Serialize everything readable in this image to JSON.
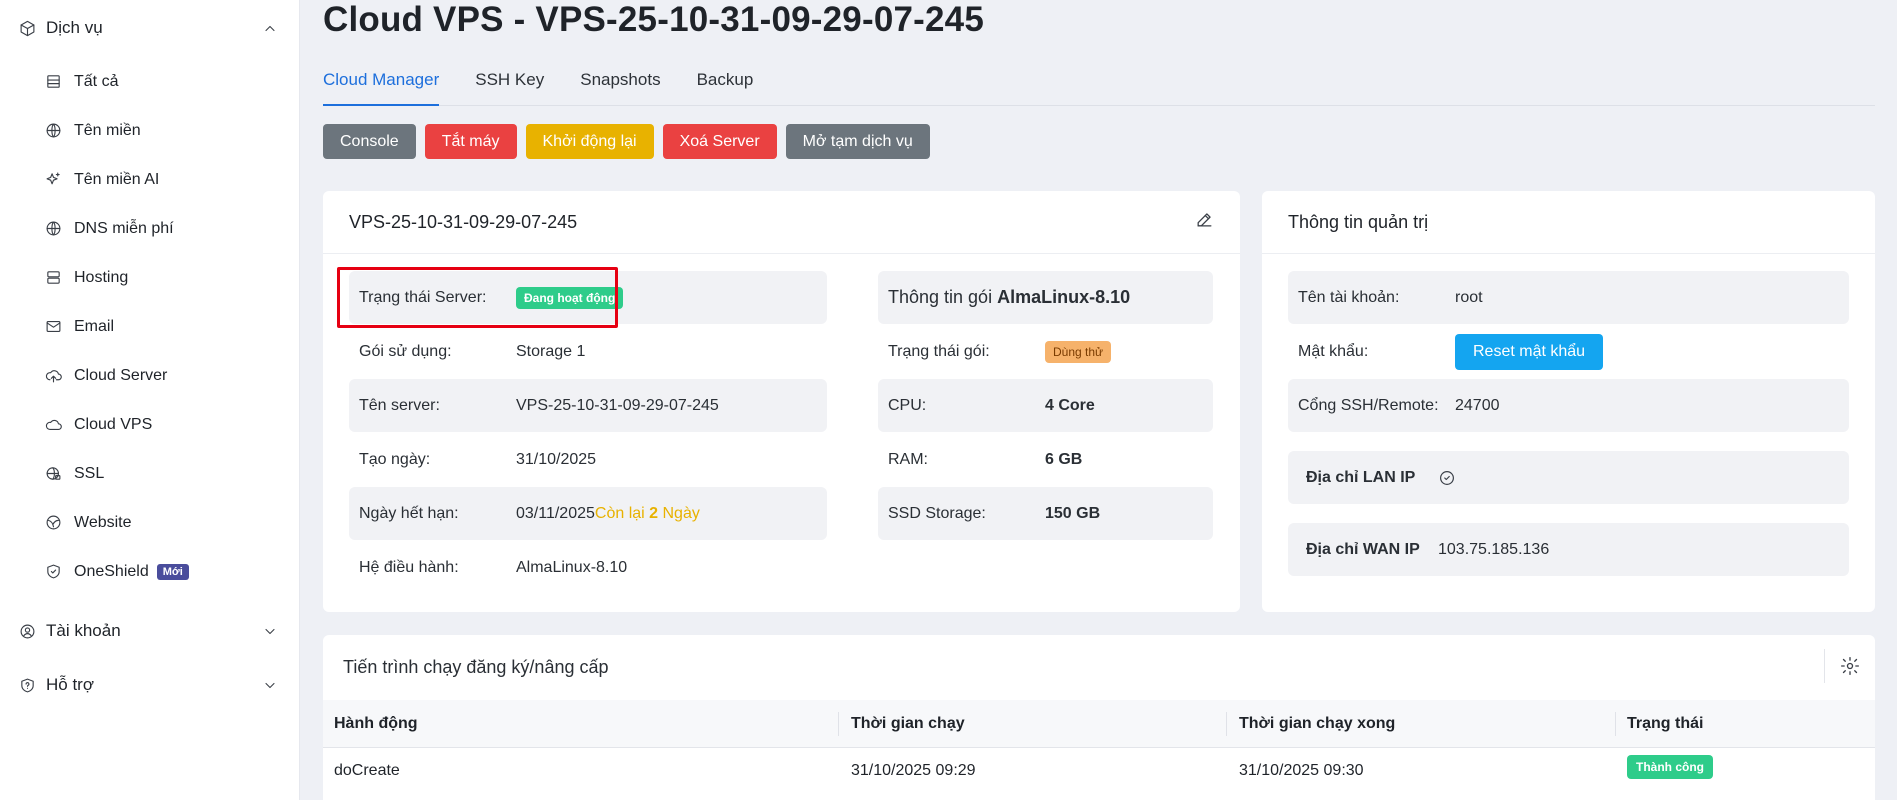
{
  "sidebar": {
    "services_group": "Dịch vụ",
    "items": [
      {
        "label": "Tất cả",
        "icon": "table-icon"
      },
      {
        "label": "Tên miền",
        "icon": "globe-icon"
      },
      {
        "label": "Tên miền AI",
        "icon": "sparkle-icon"
      },
      {
        "label": "DNS miễn phí",
        "icon": "globe-icon"
      },
      {
        "label": "Hosting",
        "icon": "server-icon"
      },
      {
        "label": "Email",
        "icon": "mail-icon"
      },
      {
        "label": "Cloud Server",
        "icon": "cloud-upload-icon"
      },
      {
        "label": "Cloud VPS",
        "icon": "cloud-icon"
      },
      {
        "label": "SSL",
        "icon": "globe-lock-icon"
      },
      {
        "label": "Website",
        "icon": "web-icon"
      },
      {
        "label": "OneShield",
        "icon": "shield-icon",
        "badge": "Mới"
      }
    ],
    "account_group": "Tài khoản",
    "support_group": "Hỗ trợ"
  },
  "page": {
    "title": "Cloud VPS - VPS-25-10-31-09-29-07-245",
    "tabs": [
      "Cloud Manager",
      "SSH Key",
      "Snapshots",
      "Backup"
    ],
    "active_tab": "Cloud Manager"
  },
  "actions": {
    "console": "Console",
    "shutdown": "Tắt máy",
    "restart": "Khởi động lại",
    "delete": "Xoá Server",
    "unlock": "Mở tạm dịch vụ"
  },
  "server_card": {
    "title": "VPS-25-10-31-09-29-07-245",
    "status_label": "Trạng thái Server:",
    "status_value": "Đang hoạt động",
    "plan_label": "Gói sử dụng:",
    "plan_value": "Storage 1",
    "name_label": "Tên server:",
    "name_value": "VPS-25-10-31-09-29-07-245",
    "created_label": "Tạo ngày:",
    "created_value": "31/10/2025",
    "expire_label": "Ngày hết hạn:",
    "expire_value": "03/11/2025",
    "remain_prefix": "Còn lại ",
    "remain_days": "2",
    "remain_suffix": " Ngày",
    "os_label": "Hệ điều hành:",
    "os_value": "AlmaLinux-8.10"
  },
  "package_card": {
    "title_prefix": "Thông tin gói ",
    "title_os": "AlmaLinux-8.10",
    "pkg_status_label": "Trạng thái gói:",
    "pkg_status_value": "Dùng thử",
    "cpu_label": "CPU:",
    "cpu_value": "4 Core",
    "ram_label": "RAM:",
    "ram_value": "6 GB",
    "ssd_label": "SSD Storage:",
    "ssd_value": "150 GB"
  },
  "admin_card": {
    "title": "Thông tin quản trị",
    "user_label": "Tên tài khoản:",
    "user_value": "root",
    "password_label": "Mật khẩu:",
    "reset_label": "Reset mật khẩu",
    "ssh_label": "Cổng SSH/Remote:",
    "ssh_value": "24700",
    "lan_label": "Địa chỉ LAN IP",
    "wan_label": "Địa chỉ WAN IP",
    "wan_value": "103.75.185.136"
  },
  "process_card": {
    "title": "Tiến trình chạy đăng ký/nâng cấp",
    "columns": [
      "Hành động",
      "Thời gian chạy",
      "Thời gian chạy xong",
      "Trạng thái"
    ],
    "rows": [
      {
        "action": "doCreate",
        "start": "31/10/2025 09:29",
        "end": "31/10/2025 09:30",
        "status": "Thành công"
      }
    ]
  }
}
